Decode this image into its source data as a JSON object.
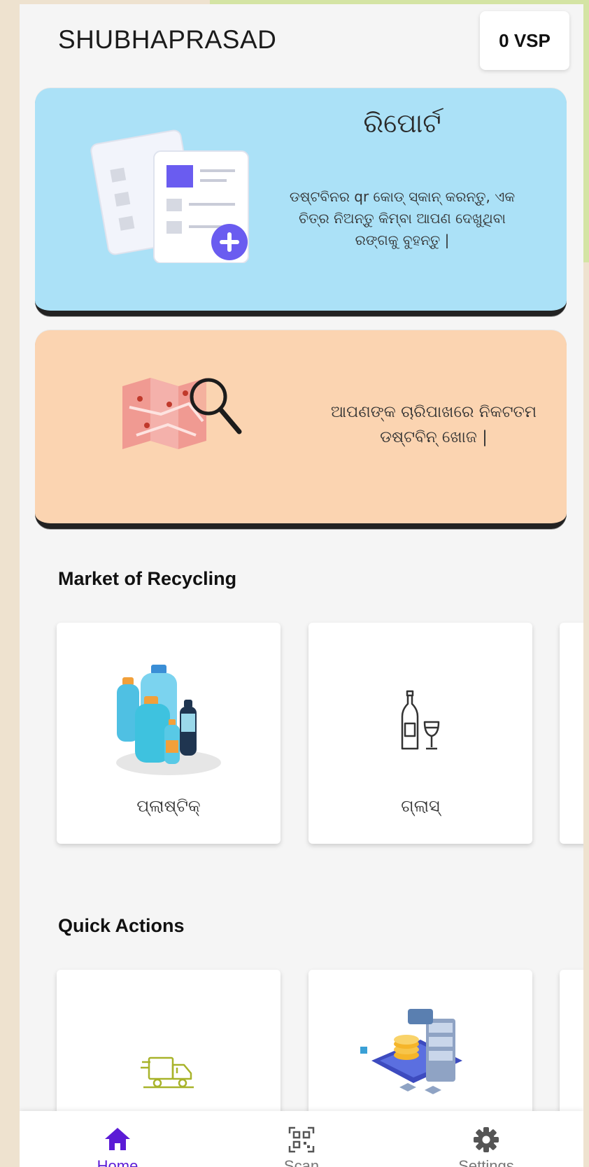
{
  "header": {
    "user_name": "SHUBHAPRASAD",
    "points": "0 VSP"
  },
  "cards": {
    "report": {
      "title": "ରିପୋର୍ଟ",
      "desc_lines": [
        "ଡଷ୍ଟବିନର qr କୋଡ୍ ସ୍କାନ୍ କରନ୍ତୁ, ଏକ",
        "ଚିତ୍ର ନିଅନ୍ତୁ କିମ୍ବା ଆପଣ ଦେଖୁଥିବା",
        "ରଙ୍ଗକୁ ବୁହନ୍ତୁ |"
      ],
      "color": "#abe1f7"
    },
    "map": {
      "desc_lines": [
        "ଆପଣଙ୍କ ଚାରିପାଖରେ ନିକଟତମ",
        "ଡଷ୍ଟବିନ୍ ଖୋଜ |"
      ],
      "color": "#fbd4b1"
    }
  },
  "market": {
    "title": "Market of Recycling",
    "items": [
      {
        "label": "ପ୍ଲାଷ୍ଟିକ୍",
        "icon": "plastic-bottles-icon"
      },
      {
        "label": "ଗ୍ଲାସ୍",
        "icon": "glass-bottle-icon"
      }
    ]
  },
  "quick_actions": {
    "title": "Quick Actions",
    "items": [
      {
        "icon": "delivery-truck-icon"
      },
      {
        "icon": "payment-server-icon"
      }
    ]
  },
  "nav": {
    "items": [
      {
        "label": "Home",
        "icon": "home-icon",
        "active": true
      },
      {
        "label": "Scan",
        "icon": "qr-scan-icon",
        "active": false
      },
      {
        "label": "Settings",
        "icon": "gear-icon",
        "active": false
      }
    ],
    "active_color": "#5b1bd6"
  }
}
